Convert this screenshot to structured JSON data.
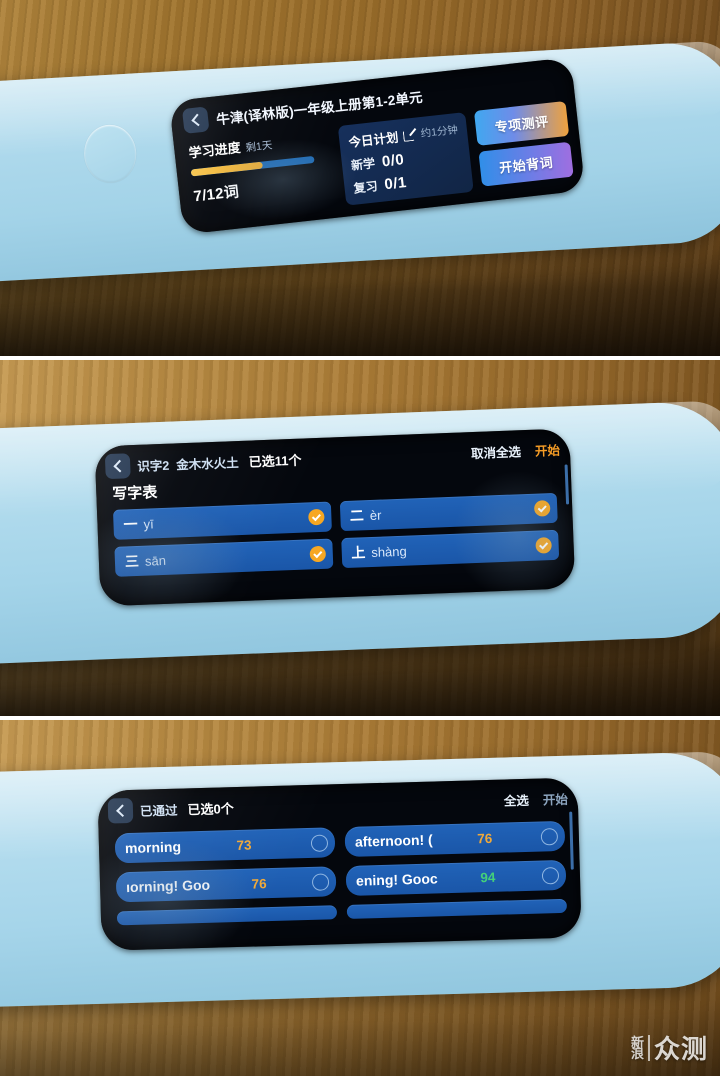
{
  "panels": [
    {
      "id": "panel-home",
      "screen": {
        "title": "牛津(译林版)一年级上册第1-2单元",
        "back_icon": "chevron-left-icon",
        "progress": {
          "label": "学习进度",
          "remaining": "剩1天",
          "percent": 58,
          "count": "7/12词",
          "fill_color": "#f1ad2d",
          "track_color": "#1b69b5"
        },
        "plan": {
          "title": "今日计划",
          "edit_icon": "edit-pencil-icon",
          "duration": "约1分钟",
          "rows": [
            {
              "label": "新学",
              "value": "0/0"
            },
            {
              "label": "复习",
              "value": "0/1"
            }
          ]
        },
        "buttons": [
          {
            "label": "专项测评",
            "name": "special-test-button"
          },
          {
            "label": "开始背词",
            "name": "start-recite-button"
          }
        ]
      }
    },
    {
      "id": "panel-character-list",
      "screen": {
        "back_icon": "chevron-left-icon",
        "title_prefix": "识字2",
        "title_main": "金木水火土",
        "selected_count": "已选11个",
        "actions": [
          {
            "label": "取消全选",
            "name": "deselect-all-button",
            "style": "normal"
          },
          {
            "label": "开始",
            "name": "start-button",
            "style": "orange"
          }
        ],
        "section_title": "写字表",
        "tiles": [
          {
            "hanzi": "一",
            "pinyin": "yī",
            "checked": true
          },
          {
            "hanzi": "二",
            "pinyin": "èr",
            "checked": true
          },
          {
            "hanzi": "三",
            "pinyin": "sān",
            "checked": true
          },
          {
            "hanzi": "上",
            "pinyin": "shàng",
            "checked": true
          }
        ]
      }
    },
    {
      "id": "panel-passed-words",
      "screen": {
        "back_icon": "chevron-left-icon",
        "title": "已通过",
        "selected_count": "已选0个",
        "actions": [
          {
            "label": "全选",
            "name": "select-all-button",
            "style": "normal"
          },
          {
            "label": "开始",
            "name": "start-button",
            "style": "dim"
          }
        ],
        "tiles": [
          {
            "word": "morning",
            "score": "73",
            "score_color": "orange",
            "checked": false
          },
          {
            "word": "afternoon! (",
            "score": "76",
            "score_color": "orange",
            "checked": false
          },
          {
            "word": "ıorning!  Goo",
            "score": "76",
            "score_color": "orange",
            "checked": false
          },
          {
            "word": "ening!  Gooc",
            "score": "94",
            "score_color": "green",
            "checked": false
          }
        ]
      }
    }
  ],
  "watermark": {
    "small_top": "新",
    "small_bottom": "浪",
    "big": "众测"
  }
}
